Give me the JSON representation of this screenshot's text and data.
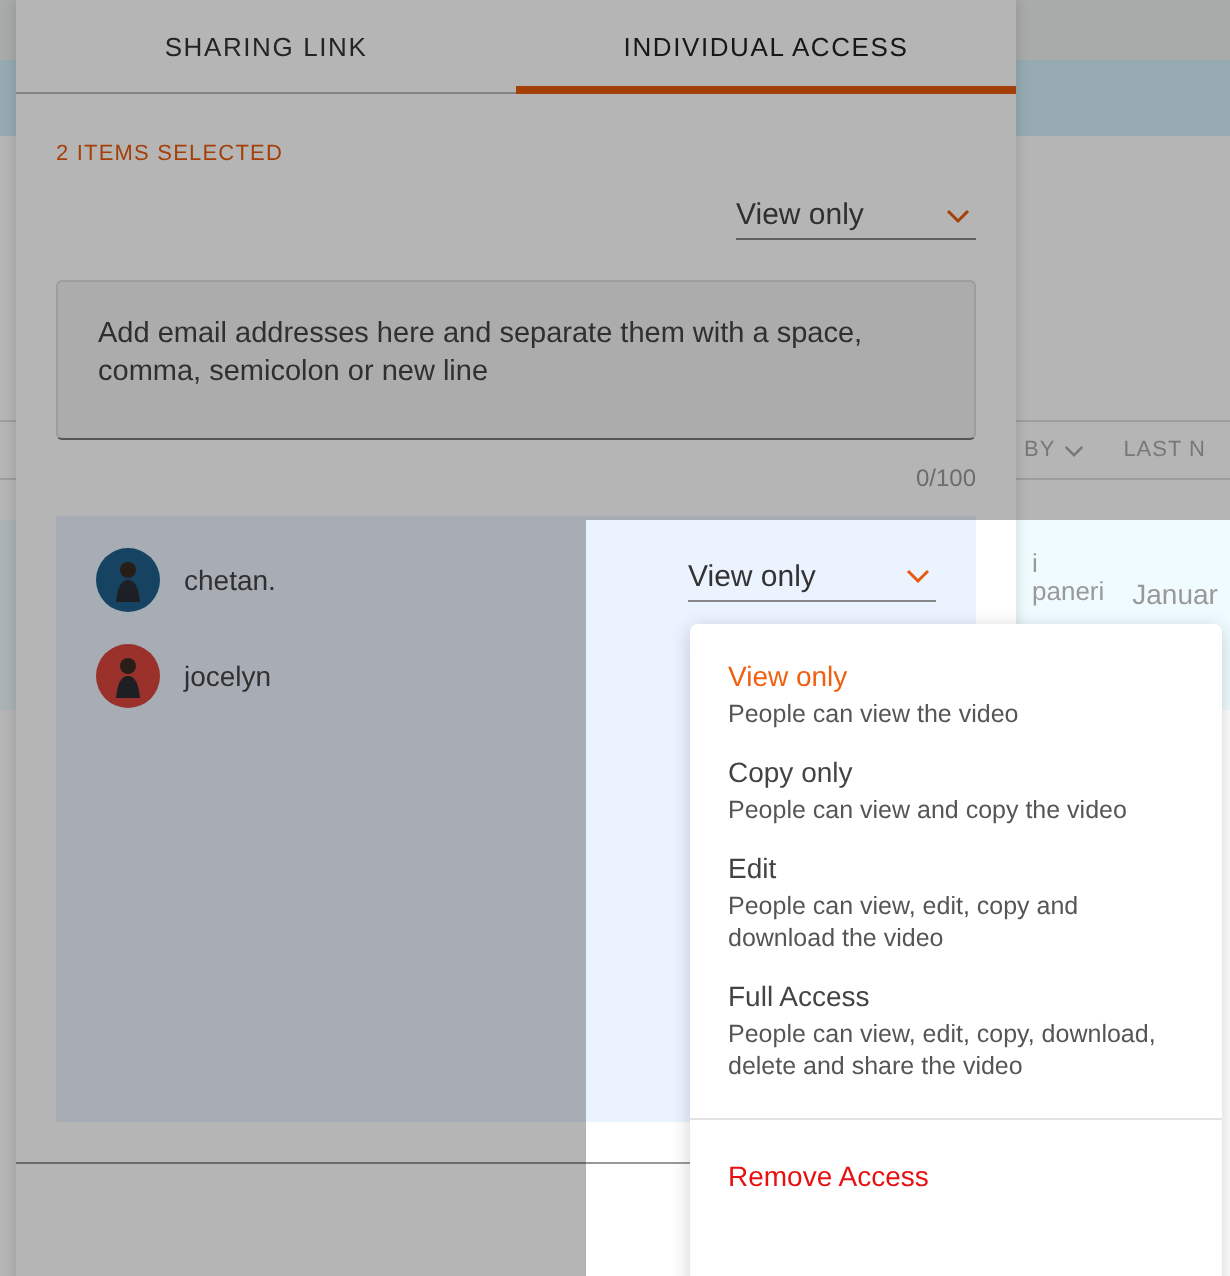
{
  "background_page": {
    "columns": [
      {
        "label": "BY",
        "sortable": true
      },
      {
        "label": "LAST N",
        "sortable": false
      }
    ],
    "rows": [
      {
        "name_lines": [
          "i",
          "paneri"
        ],
        "date": "Januar"
      }
    ]
  },
  "dialog": {
    "tabs": [
      {
        "label": "SHARING LINK",
        "selected": false
      },
      {
        "label": "INDIVIDUAL ACCESS",
        "selected": true
      }
    ],
    "selection_count": "2 ITEMS SELECTED",
    "default_permission": {
      "value": "View only"
    },
    "email_field": {
      "placeholder": "Add email addresses here and separate them with a space, comma, semicolon or new line",
      "counter": "0/100"
    },
    "users": [
      {
        "name": "chetan.",
        "permission": {
          "value": "View only",
          "expanded": true
        }
      },
      {
        "name": "jocelyn"
      }
    ],
    "permission_menu": {
      "options": [
        {
          "label": "View only",
          "description": "People can view the video",
          "selected": true
        },
        {
          "label": "Copy only",
          "description": "People can view and copy the video",
          "selected": false
        },
        {
          "label": "Edit",
          "description": "People can view, edit, copy and download the video",
          "selected": false
        },
        {
          "label": "Full Access",
          "description": "People can view, edit, copy, download, delete and share the video",
          "selected": false
        }
      ],
      "remove_action": "Remove Access"
    }
  },
  "spotlight": {
    "on": true
  }
}
